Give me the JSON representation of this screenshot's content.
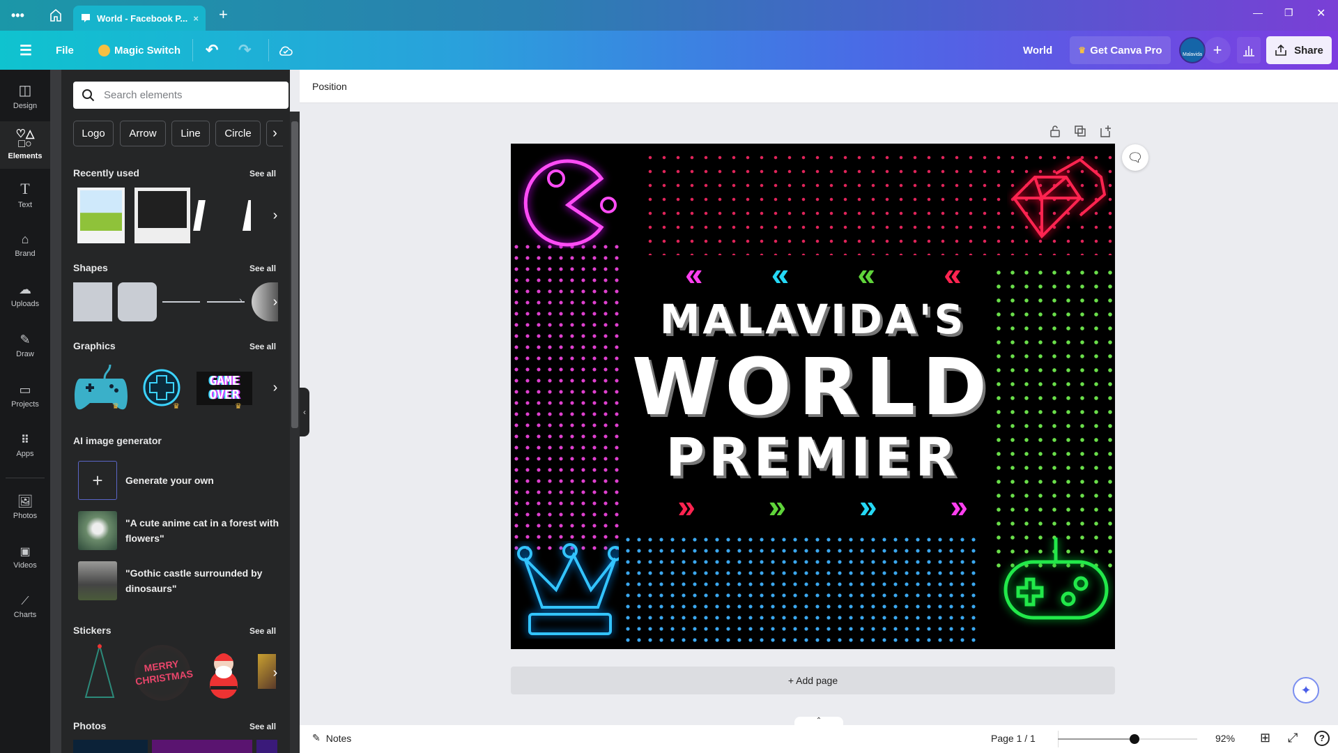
{
  "browser": {
    "tab_title": "World - Facebook P...",
    "menu_icon": "more-dots-icon",
    "home_icon": "home-icon",
    "new_tab": "+",
    "close": "×"
  },
  "toolbar": {
    "file": "File",
    "magic_switch": "Magic Switch",
    "design_name": "World",
    "get_pro": "Get Canva Pro",
    "avatar_label": "Malavida",
    "share": "Share"
  },
  "rail": [
    {
      "label": "Design",
      "icon": "layout-icon"
    },
    {
      "label": "Elements",
      "icon": "shapes-icon",
      "active": true
    },
    {
      "label": "Text",
      "icon": "text-icon"
    },
    {
      "label": "Brand",
      "icon": "brand-icon"
    },
    {
      "label": "Uploads",
      "icon": "upload-cloud-icon"
    },
    {
      "label": "Draw",
      "icon": "pen-icon"
    },
    {
      "label": "Projects",
      "icon": "folder-icon"
    },
    {
      "label": "Apps",
      "icon": "grid-icon"
    },
    {
      "label": "Photos",
      "icon": "image-icon"
    },
    {
      "label": "Videos",
      "icon": "video-icon"
    },
    {
      "label": "Charts",
      "icon": "chart-line-icon"
    }
  ],
  "panel": {
    "search_placeholder": "Search elements",
    "chips": [
      "Logo",
      "Arrow",
      "Line",
      "Circle"
    ],
    "see_all": "See all",
    "recently_used": "Recently used",
    "shapes": "Shapes",
    "graphics": "Graphics",
    "game_over": "GAME OVER",
    "ai_title": "AI image generator",
    "ai_items": [
      "Generate your own",
      "\"A cute anime cat in a forest with flowers\"",
      "\"Gothic castle surrounded by dinosaurs\""
    ],
    "stickers": "Stickers",
    "merry_christmas": "MERRY CHRISTMAS",
    "photos": "Photos"
  },
  "editor": {
    "position": "Position",
    "add_page": "+ Add page"
  },
  "design": {
    "line1": "MALAVIDA'S",
    "line2": "WORLD",
    "line3": "PREMIER",
    "colors": {
      "magenta": "#ff3ff0",
      "cyan": "#25d8f5",
      "green": "#5fd43a",
      "red": "#ff2450"
    }
  },
  "footer": {
    "notes": "Notes",
    "page": "Page 1 / 1",
    "zoom": "92%",
    "zoom_fraction": 0.55
  }
}
